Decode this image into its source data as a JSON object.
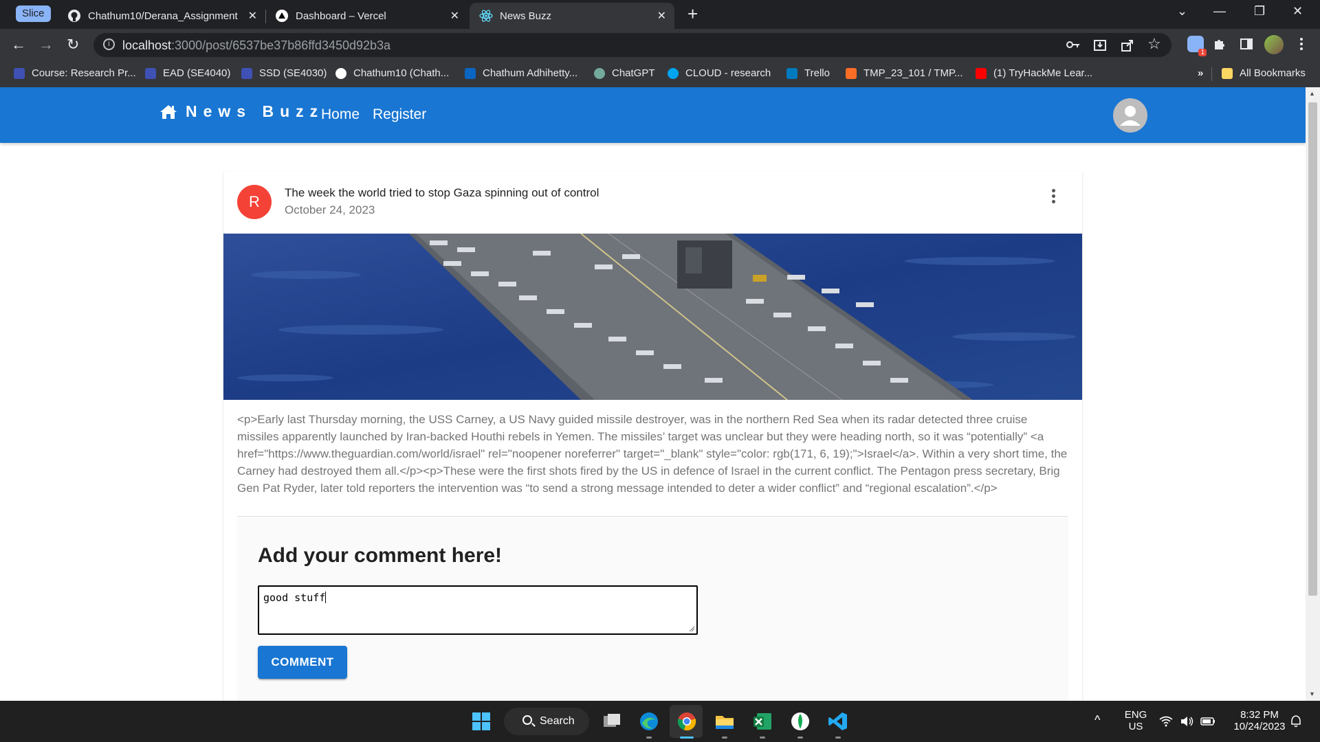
{
  "browser": {
    "tab_group_label": "Slice",
    "tabs": [
      {
        "title": "Chathum10/Derana_Assignment",
        "close": "✕"
      },
      {
        "title": "Dashboard – Vercel",
        "close": "✕"
      },
      {
        "title": "News Buzz",
        "close": "✕",
        "active": true
      }
    ],
    "new_tab": "+",
    "window_controls": {
      "dropdown": "⌄",
      "minimize": "—",
      "restore": "❐",
      "close": "✕"
    },
    "nav": {
      "back": "←",
      "forward": "→",
      "reload": "↻"
    },
    "address": {
      "host": "localhost",
      "path": ":3000/post/6537be37b86ffd3450d92b3a"
    },
    "omnibox_icons": {
      "key": "key-icon",
      "install": "install-icon",
      "share": "share-icon",
      "star": "☆"
    },
    "extension_badge_count": "1",
    "bookmarks": [
      {
        "label": "Course: Research Pr...",
        "color": "#3f51b5"
      },
      {
        "label": "EAD (SE4040)",
        "color": "#3f51b5"
      },
      {
        "label": "SSD (SE4030)",
        "color": "#3f51b5"
      },
      {
        "label": "Chathum10 (Chath...",
        "color": "#ffffff"
      },
      {
        "label": "Chathum Adhihetty...",
        "color": "#0a66c2"
      },
      {
        "label": "ChatGPT",
        "color": "#74aa9c"
      },
      {
        "label": "CLOUD - research",
        "color": "#00a4ef"
      },
      {
        "label": "Trello",
        "color": "#0079bf"
      },
      {
        "label": "TMP_23_101 / TMP...",
        "color": "#fc6d26"
      },
      {
        "label": "(1) TryHackMe Lear...",
        "color": "#ff0000"
      }
    ],
    "bookmarks_overflow": "»",
    "all_bookmarks": "All Bookmarks"
  },
  "app": {
    "brand": "News Buzz",
    "nav": {
      "home": "Home",
      "register": "Register"
    }
  },
  "post": {
    "avatar_letter": "R",
    "title": "The week the world tried to stop Gaza spinning out of control",
    "date": "October 24, 2023",
    "body": "<p>Early last Thursday morning, the USS Carney, a US Navy guided missile destroyer, was in the northern Red Sea when its radar detected three cruise missiles apparently launched by Iran-backed Houthi rebels in Yemen. The missiles’ target was unclear but they were heading north, so it was “potentially” <a href=\"https://www.theguardian.com/world/israel\" rel=\"noopener noreferrer\" target=\"_blank\" style=\"color: rgb(171, 6, 19);\">Israel</a>. Within a very short time, the Carney had destroyed them all.</p><p>These were the first shots fired by the US in defence of Israel in the current conflict. The Pentagon press secretary, Brig Gen Pat Ryder, later told reporters the intervention was “to send a strong message intended to deter a wider conflict” and “regional escalation”.</p>"
  },
  "comment": {
    "heading": "Add your comment here!",
    "value": "good stuff",
    "button": "COMMENT"
  },
  "taskbar": {
    "search_label": "Search",
    "language": "ENG",
    "region": "US",
    "time": "8:32 PM",
    "date": "10/24/2023",
    "tray_chevron": "^"
  },
  "colors": {
    "app_bar": "#1976d2",
    "post_avatar": "#f44336",
    "button": "#1976d2"
  }
}
